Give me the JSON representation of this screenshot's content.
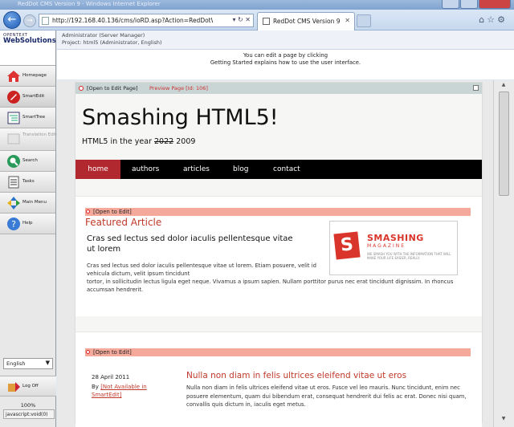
{
  "window": {
    "title": "RedDot CMS Version 9 - Windows Internet Explorer"
  },
  "browser": {
    "url": "http://192.168.40.136/cms/ioRD.asp?Action=RedDotWorks",
    "tab_label": "RedDot CMS Version 9",
    "zoom": "100%",
    "status_text": "javascript:void(0)"
  },
  "cms": {
    "logo_top": "OPENTEXT",
    "logo_bottom": "WebSolutions",
    "user_line": "Administrator (Server Manager)",
    "project_line": "Project: html5 (Administrator, English)",
    "info_line1": "You can edit a page by clicking",
    "info_line2": "Getting Started explains how to use the user interface.",
    "nav": [
      {
        "label": "Homepage",
        "icon": "house-icon"
      },
      {
        "label": "SmartEdit",
        "icon": "smartedit-icon"
      },
      {
        "label": "SmartTree",
        "icon": "tree-icon"
      },
      {
        "label": "Translation Editor",
        "icon": "translation-icon"
      },
      {
        "label": "Search",
        "icon": "search-icon"
      },
      {
        "label": "Tasks",
        "icon": "tasks-icon"
      },
      {
        "label": "Main Menu",
        "icon": "main-menu-icon"
      },
      {
        "label": "Help",
        "icon": "help-icon"
      }
    ],
    "language": "English",
    "logoff_label": "Log Off"
  },
  "page": {
    "open_to_edit_page": "[Open to Edit Page]",
    "preview_page": "Preview Page [Id: 106]",
    "site_title": "Smashing HTML5!",
    "tagline_prefix": "HTML5 in the year",
    "tagline_struck": "2022",
    "tagline_suffix": "2009",
    "menu": [
      "home",
      "authors",
      "articles",
      "blog",
      "contact"
    ],
    "open_to_edit": "[Open to Edit]",
    "featured_label": "Featured Article",
    "featured_heading": "Cras sed lectus sed dolor iaculis pellentesque vitae ut lorem",
    "featured_body1": "Cras sed lectus sed dolor iaculis pellentesque vitae ut lorem. Etiam posuere, velit id vehicula dictum, velit ipsum tincidunt",
    "featured_body2": "tortor, in sollicitudin lectus ligula eget neque. Vivamus a ipsum sapien. Nullam porttitor purus nec erat tincidunt dignissim. In rhoncus accumsan hendrerit.",
    "ad": {
      "brand": "SMASHING",
      "sub": "MAGAZINE",
      "tagline": "WE SMASH YOU WITH THE INFORMATION THAT WILL MAKE YOUR LIFE EASIER. REALLY."
    },
    "article2": {
      "date": "28 April 2011",
      "by_label": "By",
      "by_value": "[Not Available in SmartEdit]",
      "title": "Nulla non diam in felis ultrices eleifend vitae ut eros",
      "body": "Nulla non diam in felis ultrices eleifend vitae ut eros. Fusce vel leo mauris. Nunc tincidunt, enim nec posuere elementum, quam dui bibendum erat, consequat hendrerit dui felis ac erat. Donec nisi quam, convallis quis dictum in, iaculis eget metus."
    }
  },
  "colors": {
    "accent_red": "#b1292f",
    "edit_bar": "#f4a99b",
    "link_red": "#c0392b"
  }
}
